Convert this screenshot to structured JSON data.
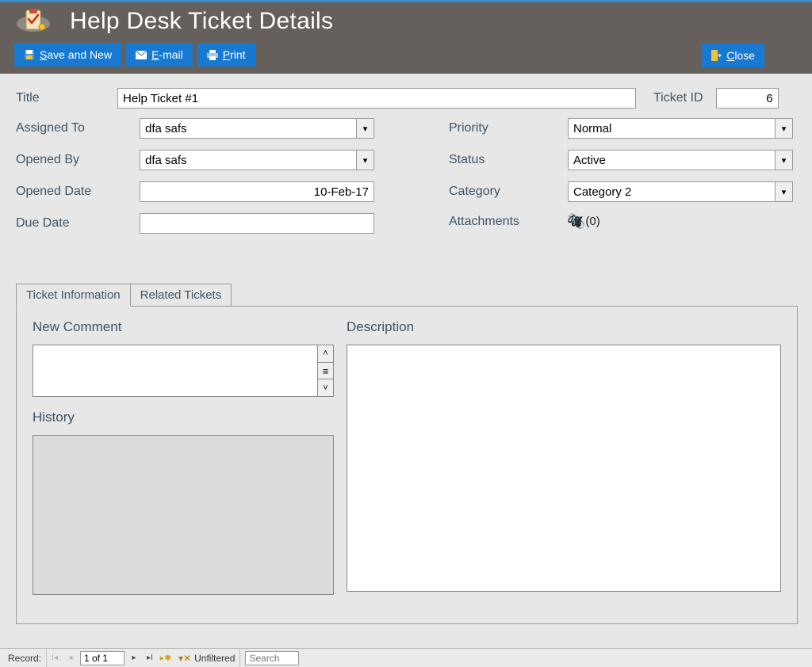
{
  "header": {
    "title": "Help Desk Ticket Details",
    "buttons": {
      "save_and_new": "Save and New",
      "email": "E-mail",
      "print": "Print",
      "close": "Close"
    }
  },
  "fields": {
    "title_label": "Title",
    "title_value": "Help Ticket #1",
    "ticket_id_label": "Ticket ID",
    "ticket_id_value": "6",
    "assigned_to_label": "Assigned To",
    "assigned_to_value": "dfa safs",
    "opened_by_label": "Opened By",
    "opened_by_value": "dfa safs",
    "opened_date_label": "Opened Date",
    "opened_date_value": "10-Feb-17",
    "due_date_label": "Due Date",
    "due_date_value": "",
    "priority_label": "Priority",
    "priority_value": "Normal",
    "status_label": "Status",
    "status_value": "Active",
    "category_label": "Category",
    "category_value": "Category 2",
    "attachments_label": "Attachments",
    "attachments_value": "(0)"
  },
  "tabs": {
    "ticket_info": "Ticket Information",
    "related": "Related Tickets"
  },
  "panel": {
    "new_comment_label": "New Comment",
    "history_label": "History",
    "description_label": "Description"
  },
  "recnav": {
    "label": "Record:",
    "position": "1 of 1",
    "filter_text": "Unfiltered",
    "search_placeholder": "Search"
  }
}
